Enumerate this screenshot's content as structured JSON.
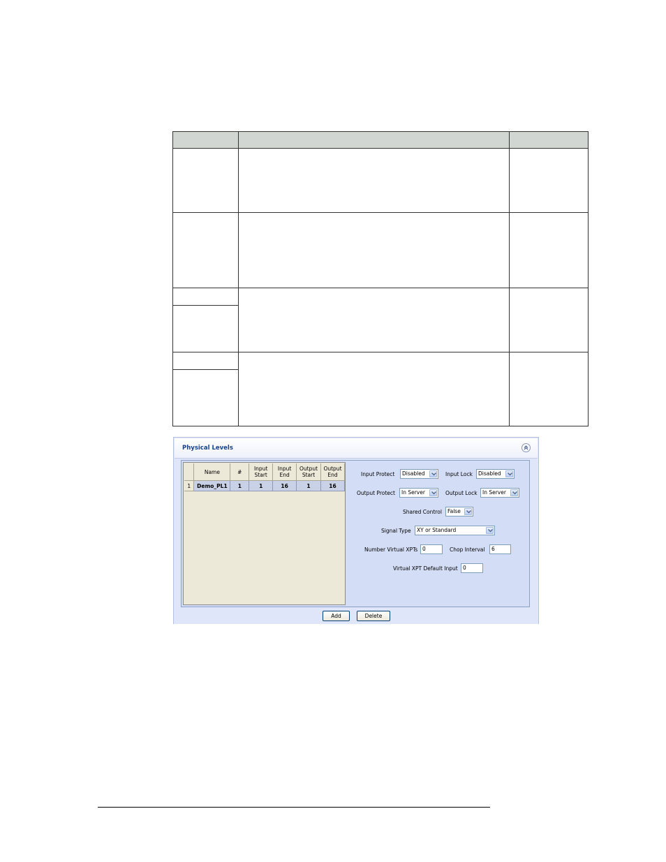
{
  "panel": {
    "title": "Physical Levels",
    "grid": {
      "columns": [
        "Name",
        "#",
        "Input Start",
        "Input End",
        "Output Start",
        "Output End"
      ],
      "rows": [
        {
          "row": "1",
          "name": "Demo_PL1",
          "num": "1",
          "input_start": "1",
          "input_end": "16",
          "output_start": "1",
          "output_end": "16"
        }
      ]
    },
    "fields": {
      "input_protect": {
        "label": "Input Protect",
        "value": "Disabled"
      },
      "input_lock": {
        "label": "Input Lock",
        "value": "Disabled"
      },
      "output_protect": {
        "label": "Output Protect",
        "value": "In Server"
      },
      "output_lock": {
        "label": "Output Lock",
        "value": "In Server"
      },
      "shared_control": {
        "label": "Shared Control",
        "value": "False"
      },
      "signal_type": {
        "label": "Signal Type",
        "value": "XY or Standard"
      },
      "number_virtual_xpts": {
        "label": "Number Virtual XPTs",
        "value": "0"
      },
      "chop_interval": {
        "label": "Chop Interval",
        "value": "6"
      },
      "virtual_xpt_default_input": {
        "label": "Virtual XPT Default Input",
        "value": "0"
      }
    },
    "buttons": {
      "add": "Add",
      "delete": "Delete"
    }
  }
}
